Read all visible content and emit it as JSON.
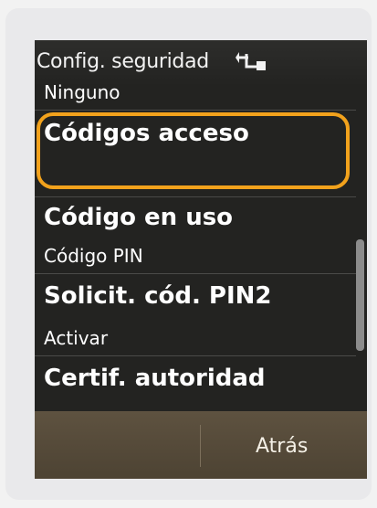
{
  "header": {
    "title": "Config. seguridad",
    "icon": "lock-key-icon"
  },
  "list": [
    {
      "kind": "value",
      "text": "Ninguno"
    },
    {
      "kind": "title",
      "text": "Códigos acceso",
      "selected": true
    },
    {
      "kind": "title",
      "text": "Código en uso"
    },
    {
      "kind": "value",
      "text": "Código PIN"
    },
    {
      "kind": "title",
      "text": "Solicit. cód. PIN2"
    },
    {
      "kind": "value",
      "text": "Activar"
    },
    {
      "kind": "title",
      "text": "Certif. autoridad"
    }
  ],
  "softkeys": {
    "right_label": "Atrás"
  },
  "colors": {
    "highlight": "#f2a21c",
    "background": "#232321",
    "softkey_bar": "#5e5240"
  }
}
